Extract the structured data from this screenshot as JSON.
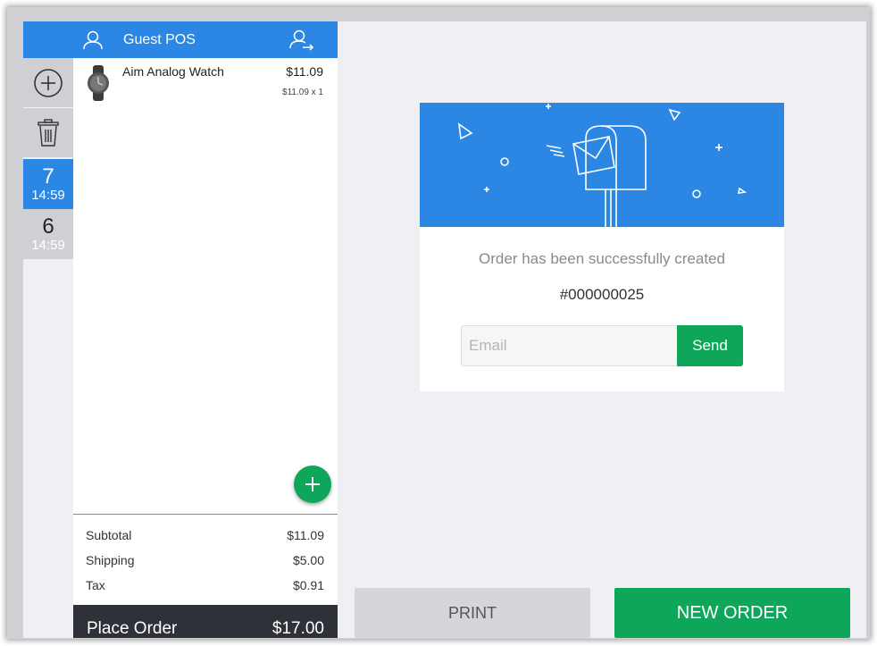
{
  "colors": {
    "primary_blue": "#2b87e3",
    "action_green": "#0ea75a",
    "dark_bar": "#2e3138",
    "background": "#efeff4"
  },
  "tabs": {
    "add_icon": "plus-circle-icon",
    "delete_icon": "trash-icon",
    "orders": [
      {
        "number": "7",
        "time": "14:59",
        "active": true
      },
      {
        "number": "6",
        "time": "14:59",
        "active": false
      }
    ]
  },
  "cart": {
    "header": {
      "customer_icon": "user-icon",
      "customer_name": "Guest POS",
      "switch_icon": "switch-customer-icon"
    },
    "items": [
      {
        "name": "Aim Analog Watch",
        "price": "$11.09",
        "qty_line": "$11.09 x 1",
        "thumb_icon": "watch-icon"
      }
    ],
    "add_product_icon": "plus-icon",
    "totals": {
      "subtotal_label": "Subtotal",
      "subtotal": "$11.09",
      "shipping_label": "Shipping",
      "shipping": "$5.00",
      "tax_label": "Tax",
      "tax": "$0.91"
    },
    "place_order": {
      "label": "Place Order",
      "total": "$17.00"
    }
  },
  "success": {
    "banner_icon": "mailbox-icon",
    "message": "Order has been successfully created",
    "order_number": "#000000025",
    "email_placeholder": "Email",
    "send_label": "Send"
  },
  "actions": {
    "print_label": "PRINT",
    "new_order_label": "NEW ORDER"
  }
}
